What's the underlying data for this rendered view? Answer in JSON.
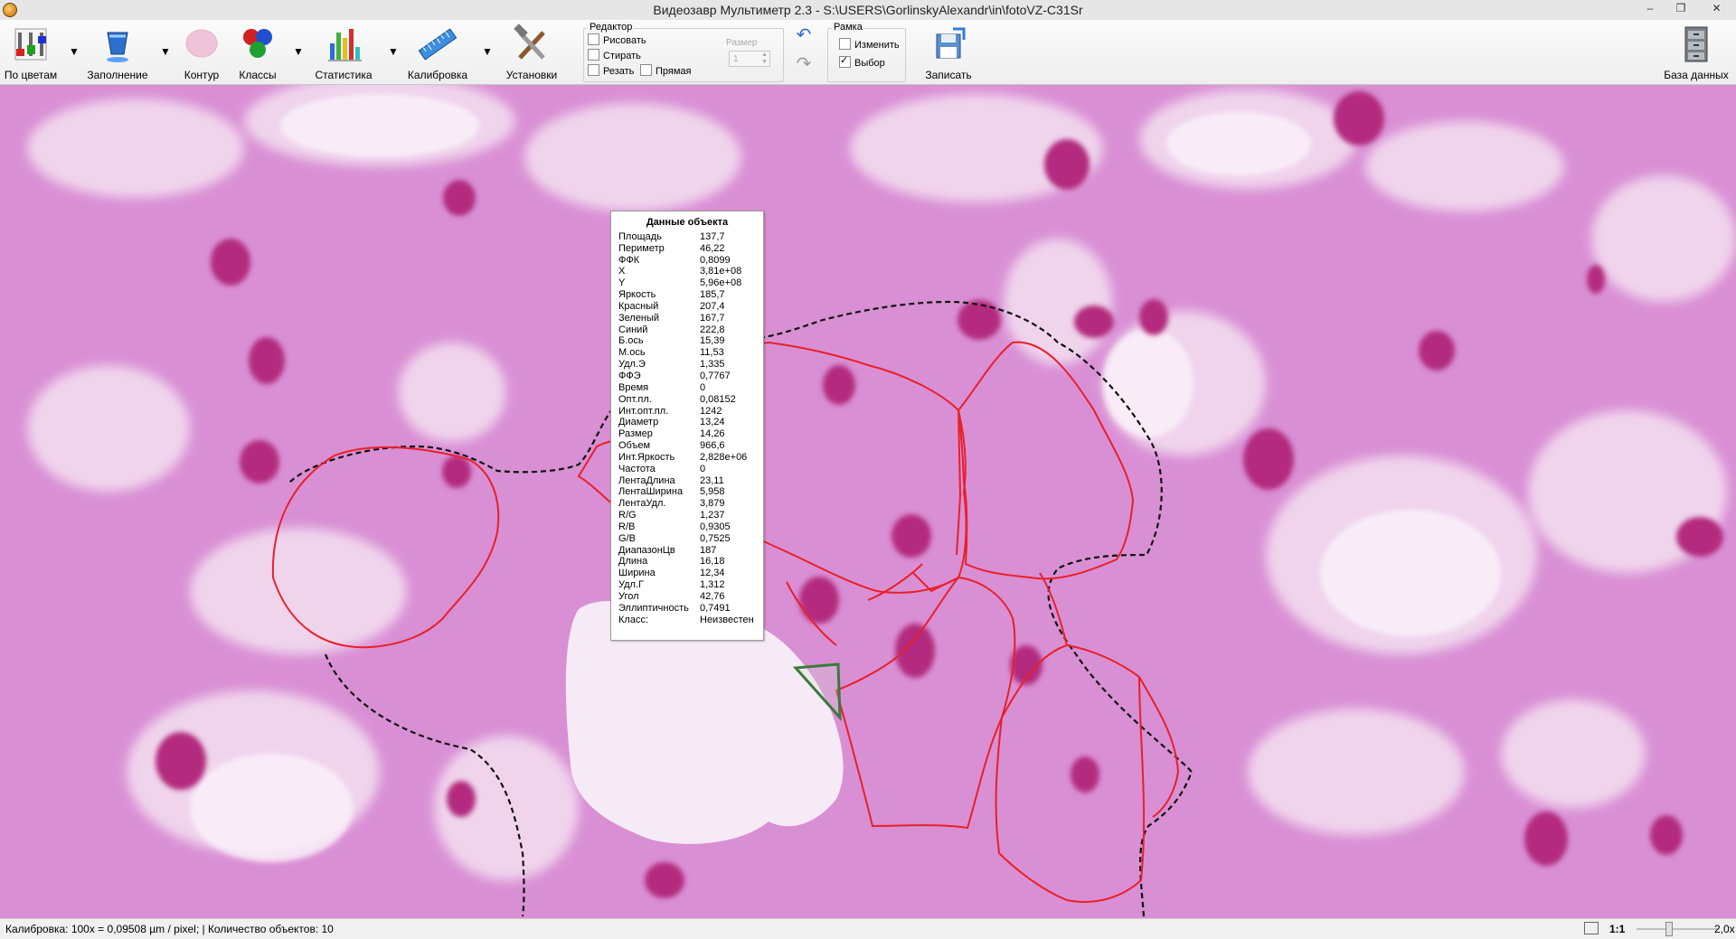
{
  "window": {
    "title": "Видеозавр Мультиметр 2.3 - S:\\USERS\\GorlinskyAlexandr\\in\\fotoVZ-C31Sr",
    "minimize": "–",
    "maximize": "❐",
    "close": "✕"
  },
  "toolbar": {
    "by_colors": "По цветам",
    "fill": "Заполнение",
    "contour": "Контур",
    "classes": "Классы",
    "statistics": "Статистика",
    "calibration": "Калибровка",
    "settings": "Установки",
    "record": "Записать",
    "database": "База данных",
    "dropdown_glyph": "▼",
    "editor": {
      "title": "Редактор",
      "draw": "Рисовать",
      "erase": "Стирать",
      "cut": "Резать",
      "straight": "Прямая",
      "size_label": "Размер",
      "size_value": "1"
    },
    "frame": {
      "title": "Рамка",
      "change": "Изменить",
      "select": "Выбор",
      "select_checked": true
    },
    "undo": "↶",
    "redo": "↷"
  },
  "object_data": {
    "title": "Данные объекта",
    "rows": [
      {
        "k": "Площадь",
        "v": "137,7"
      },
      {
        "k": "Периметр",
        "v": "46,22"
      },
      {
        "k": "ФФК",
        "v": "0,8099"
      },
      {
        "k": "X",
        "v": "3,81e+08"
      },
      {
        "k": "Y",
        "v": "5,96e+08"
      },
      {
        "k": "Яркость",
        "v": "185,7"
      },
      {
        "k": "Красный",
        "v": "207,4"
      },
      {
        "k": "Зеленый",
        "v": "167,7"
      },
      {
        "k": "Синий",
        "v": "222,8"
      },
      {
        "k": "Б.ось",
        "v": "15,39"
      },
      {
        "k": "М.ось",
        "v": "11,53"
      },
      {
        "k": "Удл.Э",
        "v": "1,335"
      },
      {
        "k": "ФФЭ",
        "v": "0,7767"
      },
      {
        "k": "Время",
        "v": "0"
      },
      {
        "k": "Опт.пл.",
        "v": "0,08152"
      },
      {
        "k": "Инт.опт.пл.",
        "v": "1242"
      },
      {
        "k": "Диаметр",
        "v": "13,24"
      },
      {
        "k": "Размер",
        "v": "14,26"
      },
      {
        "k": "Объем",
        "v": "966,6"
      },
      {
        "k": "Инт.Яркость",
        "v": "2,828e+06"
      },
      {
        "k": "Частота",
        "v": "0"
      },
      {
        "k": "ЛентаДлина",
        "v": "23,11"
      },
      {
        "k": "ЛентаШирина",
        "v": "5,958"
      },
      {
        "k": "ЛентаУдл.",
        "v": "3,879"
      },
      {
        "k": "R/G",
        "v": "1,237"
      },
      {
        "k": "R/B",
        "v": "0,9305"
      },
      {
        "k": "G/B",
        "v": "0,7525"
      },
      {
        "k": "ДиапазонЦв",
        "v": "187"
      },
      {
        "k": "Длина",
        "v": "16,18"
      },
      {
        "k": "Ширина",
        "v": "12,34"
      },
      {
        "k": "Удл.Г",
        "v": "1,312"
      },
      {
        "k": "Угол",
        "v": "42,76"
      },
      {
        "k": "Эллиптичность",
        "v": "0,7491"
      },
      {
        "k": "Класс:",
        "v": "Неизвестен"
      }
    ]
  },
  "status": {
    "calibration": "Калибровка:  100x = 0,09508 µm / pixel;  |     Количество объектов: 10",
    "ratio": "1:1",
    "zoom": "2,0x"
  },
  "colors": {
    "tissue": "#d98fd4",
    "contour": "#e8202a",
    "selected": "#3a7a3a"
  }
}
